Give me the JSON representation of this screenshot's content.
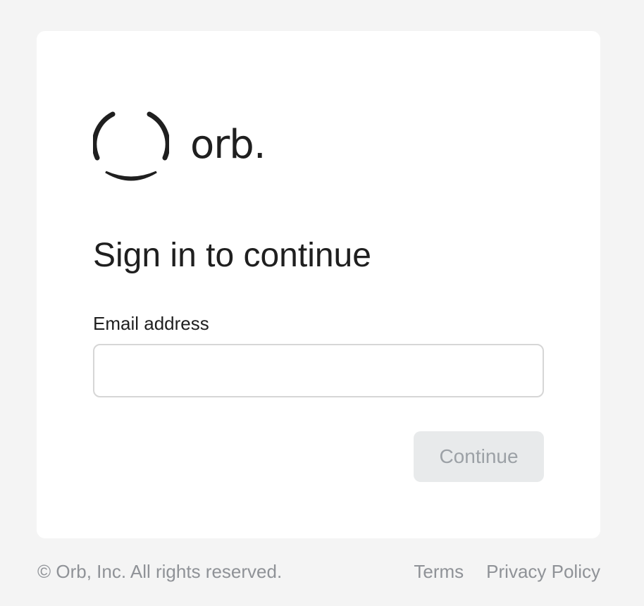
{
  "logo": {
    "icon": "orb-logo-icon",
    "wordmark": "orb."
  },
  "signin": {
    "title": "Sign in to continue",
    "email_label": "Email address",
    "email_value": "",
    "email_placeholder": "",
    "continue_label": "Continue"
  },
  "footer": {
    "copyright": "© Orb, Inc. All rights reserved.",
    "links": [
      "Terms",
      "Privacy Policy"
    ]
  },
  "colors": {
    "background": "#f4f4f4",
    "card": "#ffffff",
    "text": "#1f1f1f",
    "muted": "#8f9297",
    "button_disabled_bg": "#e8eaeb",
    "button_disabled_text": "#9ca1a6"
  }
}
